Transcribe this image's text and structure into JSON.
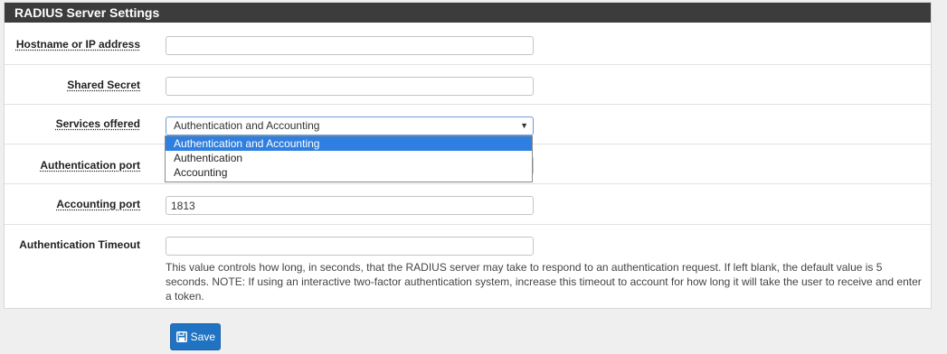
{
  "panel": {
    "title": "RADIUS Server Settings"
  },
  "fields": {
    "hostname": {
      "label": "Hostname or IP address",
      "value": ""
    },
    "shared_secret": {
      "label": "Shared Secret",
      "value": ""
    },
    "services_offered": {
      "label": "Services offered",
      "selected": "Authentication and Accounting",
      "options": [
        "Authentication and Accounting",
        "Authentication",
        "Accounting"
      ]
    },
    "auth_port": {
      "label": "Authentication port",
      "value": ""
    },
    "accounting_port": {
      "label": "Accounting port",
      "value": "1813"
    },
    "auth_timeout": {
      "label": "Authentication Timeout",
      "value": "",
      "help": "This value controls how long, in seconds, that the RADIUS server may take to respond to an authentication request. If left blank, the default value is 5 seconds. NOTE: If using an interactive two-factor authentication system, increase this timeout to account for how long it will take the user to receive and enter a token."
    }
  },
  "save_button": {
    "label": "Save",
    "icon": "floppy-disk-icon"
  },
  "colors": {
    "heading_bg": "#3c3c3c",
    "button_bg": "#1f73c2",
    "selected_option_bg": "#2f7fe0"
  }
}
